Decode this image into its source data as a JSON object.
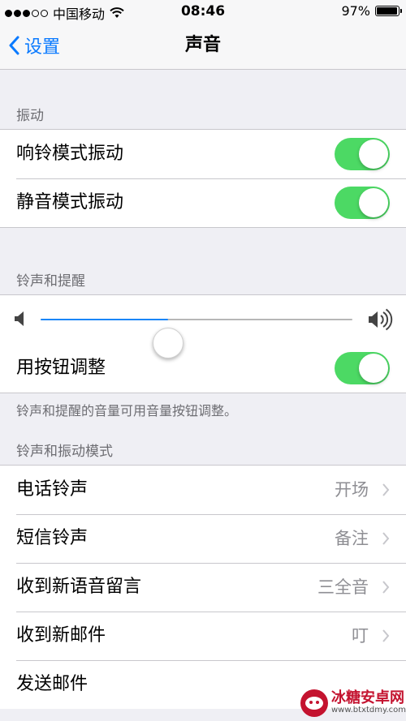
{
  "status": {
    "carrier": "中国移动",
    "time": "08:46",
    "battery": "97%",
    "battery_level": 0.97
  },
  "nav": {
    "back_label": "设置",
    "title": "声音"
  },
  "vibration": {
    "header": "振动",
    "rows": [
      {
        "label": "响铃模式振动",
        "on": true
      },
      {
        "label": "静音模式振动",
        "on": true
      }
    ]
  },
  "ringer": {
    "header": "铃声和提醒",
    "volume": 0.41,
    "adjust_with_buttons": {
      "label": "用按钮调整",
      "on": true
    },
    "footer": "铃声和提醒的音量可用音量按钮调整。"
  },
  "patterns": {
    "header": "铃声和振动模式",
    "rows": [
      {
        "label": "电话铃声",
        "value": "开场"
      },
      {
        "label": "短信铃声",
        "value": "备注"
      },
      {
        "label": "收到新语音留言",
        "value": "三全音"
      },
      {
        "label": "收到新邮件",
        "value": "叮"
      },
      {
        "label": "发送邮件",
        "value": ""
      }
    ]
  },
  "watermark": {
    "title": "冰糖安卓网",
    "url": "www.btxtdmy.com"
  },
  "colors": {
    "accent": "#0a7aff",
    "toggle_on": "#4cd964",
    "slider_fill": "#1a86f8"
  }
}
